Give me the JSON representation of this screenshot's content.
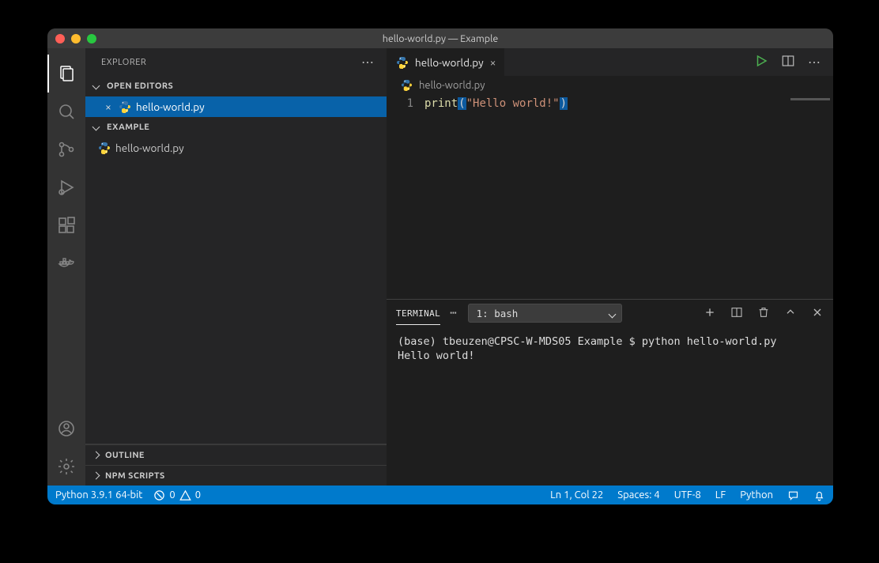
{
  "window": {
    "title": "hello-world.py — Example"
  },
  "sidebar": {
    "heading": "EXPLORER",
    "sections": {
      "openEditors": {
        "label": "OPEN EDITORS"
      },
      "folder": {
        "label": "EXAMPLE"
      },
      "outline": {
        "label": "OUTLINE"
      },
      "npm": {
        "label": "NPM SCRIPTS"
      }
    },
    "openEditorFile": "hello-world.py",
    "folderFile": "hello-world.py"
  },
  "tab": {
    "label": "hello-world.py"
  },
  "breadcrumb": {
    "file": "hello-world.py"
  },
  "editor": {
    "line_no": "1",
    "line": {
      "fn": "print",
      "open": "(",
      "str": "\"Hello world!\"",
      "close": ")"
    }
  },
  "panel": {
    "tab": "TERMINAL",
    "selector": "1: bash",
    "lines": {
      "l1": "(base) tbeuzen@CPSC-W-MDS05 Example $ python hello-world.py",
      "l2": "Hello world!"
    }
  },
  "status": {
    "python": "Python 3.9.1 64-bit",
    "errors": "0",
    "warnings": "0",
    "cursor": "Ln 1, Col 22",
    "spaces": "Spaces: 4",
    "encoding": "UTF-8",
    "eol": "LF",
    "lang": "Python"
  }
}
